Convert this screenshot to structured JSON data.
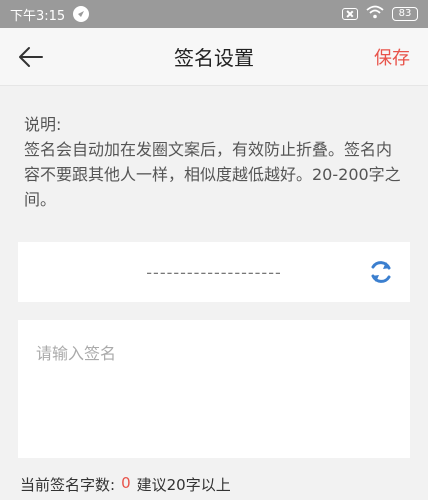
{
  "status_bar": {
    "time": "下午3:15",
    "battery": "83"
  },
  "nav": {
    "title": "签名设置",
    "save_label": "保存"
  },
  "description": {
    "label": "说明:",
    "text": "签名会自动加在发圈文案后，有效防止折叠。签名内容不要跟其他人一样，相似度越低越好。20-200字之间。"
  },
  "signature_preview": {
    "text": "--------------------"
  },
  "signature_input": {
    "value": "",
    "placeholder": "请输入签名"
  },
  "count": {
    "label": "当前签名字数:",
    "value": "0",
    "hint": "建议20字以上"
  },
  "colors": {
    "accent": "#e8534a",
    "refresh_icon": "#3b7fcf"
  }
}
